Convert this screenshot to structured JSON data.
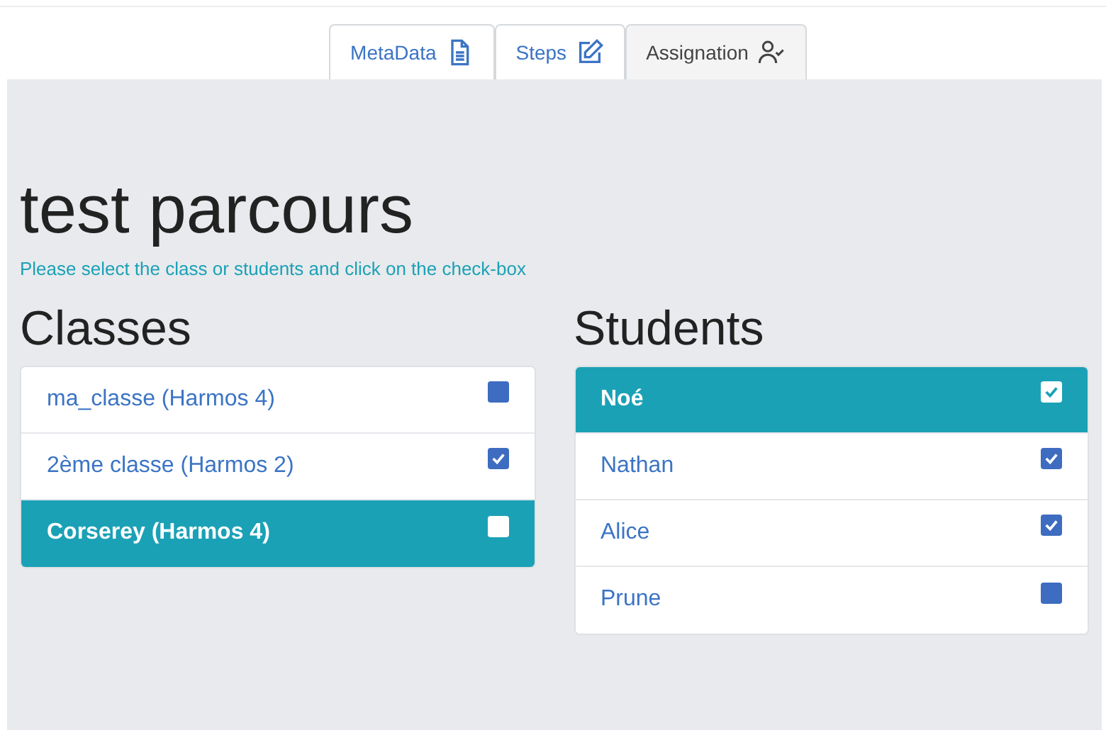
{
  "tabs": [
    {
      "label": "MetaData",
      "kind": "document",
      "selected": false
    },
    {
      "label": "Steps",
      "kind": "edit",
      "selected": false
    },
    {
      "label": "Assignation",
      "kind": "user",
      "selected": true
    }
  ],
  "title": "test parcours",
  "instruction": "Please select the class or students and click on the check-box",
  "classes": {
    "heading": "Classes",
    "items": [
      {
        "label": "ma_classe (Harmos 4)",
        "selected": false,
        "checked": false
      },
      {
        "label": "2ème classe (Harmos 2)",
        "selected": false,
        "checked": true
      },
      {
        "label": "Corserey (Harmos 4)",
        "selected": true,
        "checked": false
      }
    ]
  },
  "students": {
    "heading": "Students",
    "items": [
      {
        "label": "Noé",
        "selected": true,
        "checked": true
      },
      {
        "label": "Nathan",
        "selected": false,
        "checked": true
      },
      {
        "label": "Alice",
        "selected": false,
        "checked": true
      },
      {
        "label": "Prune",
        "selected": false,
        "checked": false
      }
    ]
  }
}
